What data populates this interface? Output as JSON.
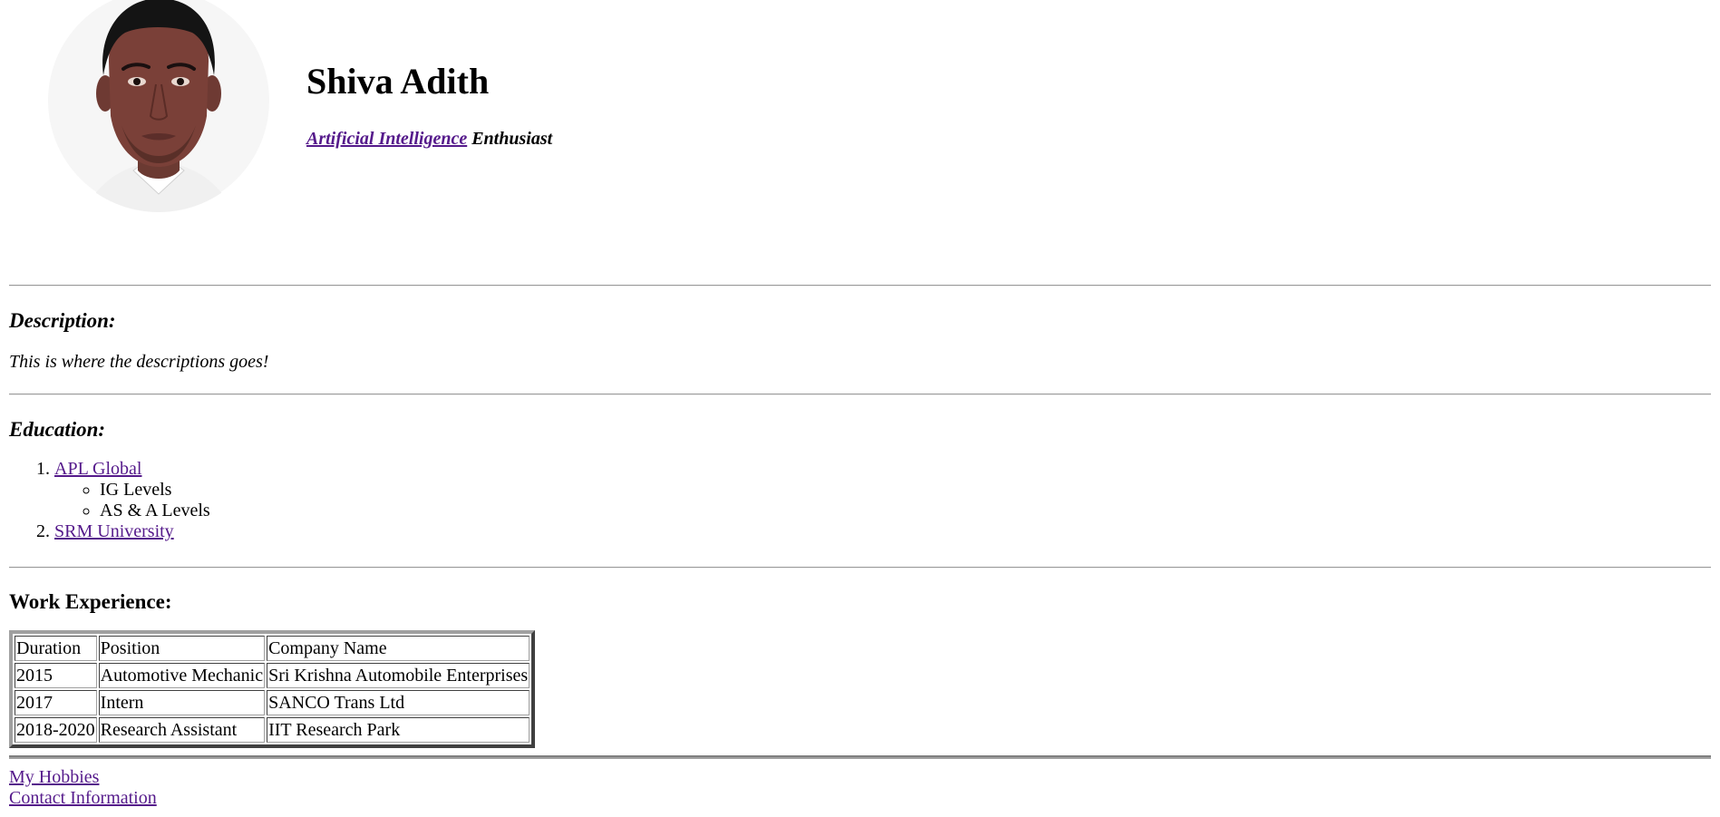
{
  "profile": {
    "photo_alt": "Portrait of Shiva Adith",
    "name": "Shiva Adith",
    "tagline_link": "Artificial Intelligence",
    "tagline_rest": "Enthusiast"
  },
  "description": {
    "heading": "Description:",
    "text": "This is where the descriptions goes!"
  },
  "education": {
    "heading": "Education:",
    "items": [
      {
        "label": "APL Global",
        "sub": [
          "IG Levels",
          "AS & A Levels"
        ]
      },
      {
        "label": "SRM University",
        "sub": []
      }
    ]
  },
  "work": {
    "heading": "Work Experience:",
    "columns": [
      "Duration",
      "Position",
      "Company Name"
    ],
    "rows": [
      [
        "2015",
        "Automotive Mechanic",
        "Sri Krishna Automobile Enterprises"
      ],
      [
        "2017",
        "Intern",
        "SANCO Trans Ltd"
      ],
      [
        "2018-2020",
        "Research Assistant",
        "IIT Research Park"
      ]
    ]
  },
  "footer": {
    "links": [
      "My Hobbies",
      "Contact Information"
    ]
  },
  "colors": {
    "link": "#551a8b",
    "text": "#000000",
    "rule": "#9a9a9a"
  }
}
